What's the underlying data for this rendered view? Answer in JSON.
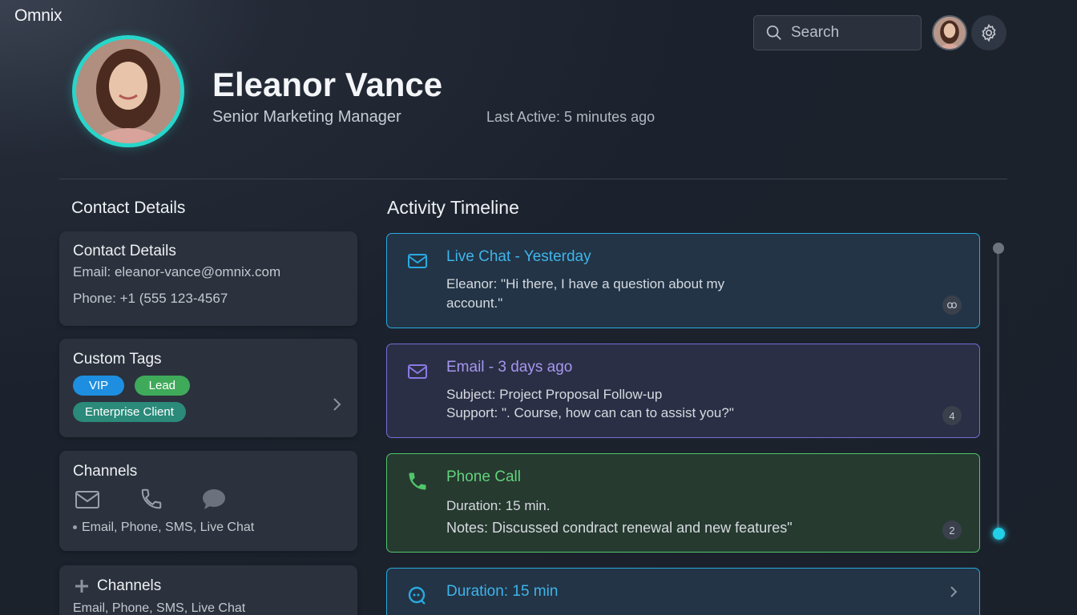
{
  "app": {
    "logo": "Omnix"
  },
  "search": {
    "placeholder": "Search"
  },
  "profile": {
    "name": "Eleanor Vance",
    "role": "Senior Marketing Manager",
    "last_active": "Last Active: 5 minutes ago"
  },
  "contact": {
    "section_title": "Contact Details",
    "card_title": "Contact Details",
    "email": "Email: eleanor-vance@omnix.com",
    "phone": "Phone: +1 (555 123-4567"
  },
  "tags": {
    "title": "Custom Tags",
    "items": [
      {
        "label": "VIP",
        "color": "#1e8fe0"
      },
      {
        "label": "Lead",
        "color": "#3faa5a"
      },
      {
        "label": "Enterprise Client",
        "color": "#2b8a7a"
      }
    ]
  },
  "channels": {
    "title": "Channels",
    "icons": [
      "mail-icon",
      "phone-icon",
      "chat-bubble-icon"
    ],
    "summary": "Email, Phone, SMS, Live Chat"
  },
  "channels2": {
    "title": "Channels",
    "summary": "Email, Phone, SMS, Live Chat"
  },
  "timeline": {
    "title": "Activity Timeline",
    "items": [
      {
        "title": "Live Chat - Yesterday",
        "line1": "Eleanor: \"Hi there, I have a question about my",
        "line2": "account.\"",
        "badge": "ꝏ",
        "accent": "#2aa9e0",
        "icon": "mail-icon"
      },
      {
        "title": "Email - 3 days ago",
        "line1": "Subject: Project Proposal Follow-up",
        "line2": "Support: \". Course, how can can to assist you?\"",
        "badge": "4",
        "accent": "#8a79e6",
        "icon": "mail-icon"
      },
      {
        "title": "Phone Call",
        "line1": "Duration: 15 min.",
        "line2": "Notes: Discussed condract renewal and new features\"",
        "badge": "2",
        "accent": "#4fc66a",
        "icon": "phone-icon"
      },
      {
        "title": "Duration: 15 min",
        "line1": "",
        "accent": "#2aa9e0",
        "icon": "chat-icon"
      }
    ]
  }
}
